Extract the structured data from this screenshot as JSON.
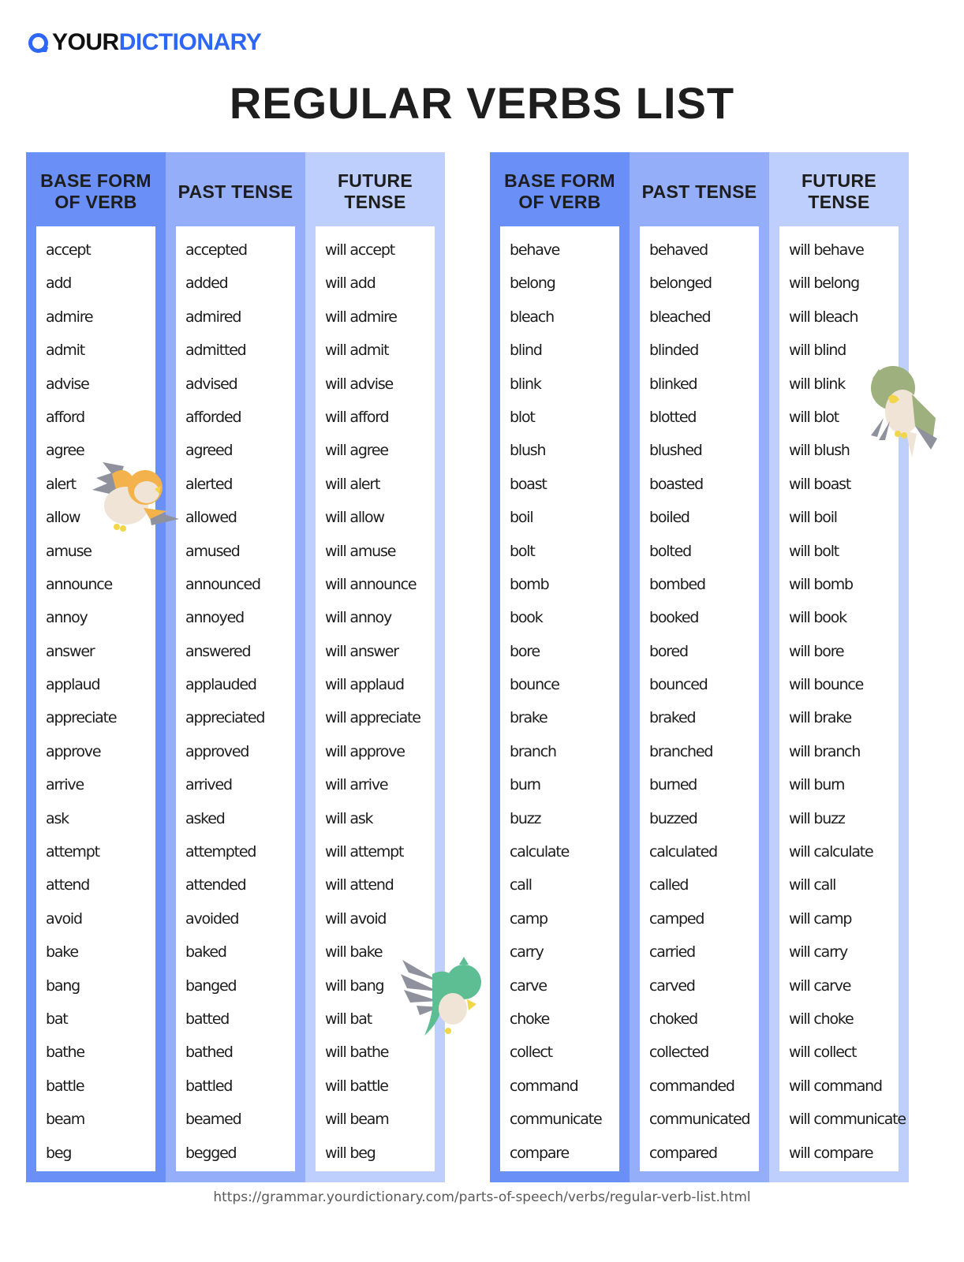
{
  "brand": {
    "logo_icon": "search-magnifier-icon",
    "name_part1": "YOUR",
    "name_part2": "DICTIONARY",
    "colors": {
      "primary": "#2e66f5",
      "dark": "#111111"
    }
  },
  "title": "REGULAR VERBS LIST",
  "colors": {
    "base_column": "#6a8ff7",
    "past_column": "#95aefa",
    "future_column": "#bfcffd"
  },
  "tables": [
    {
      "headers": {
        "base": "BASE FORM OF VERB",
        "past": "PAST TENSE",
        "future": "FUTURE TENSE"
      },
      "base": [
        "accept",
        "add",
        "admire",
        "admit",
        "advise",
        "afford",
        "agree",
        "alert",
        "allow",
        "amuse",
        "announce",
        "annoy",
        "answer",
        "applaud",
        "appreciate",
        "approve",
        "arrive",
        "ask",
        "attempt",
        "attend",
        "avoid",
        "bake",
        "bang",
        "bat",
        "bathe",
        "battle",
        "beam",
        "beg"
      ],
      "past": [
        "accepted",
        "added",
        "admired",
        "admitted",
        "advised",
        "afforded",
        "agreed",
        "alerted",
        "allowed",
        "amused",
        "announced",
        "annoyed",
        "answered",
        "applauded",
        "appreciated",
        "approved",
        "arrived",
        "asked",
        "attempted",
        "attended",
        "avoided",
        "baked",
        "banged",
        "batted",
        "bathed",
        "battled",
        "beamed",
        "begged"
      ],
      "future": [
        "will accept",
        "will add",
        "will admire",
        "will admit",
        "will advise",
        "will afford",
        "will agree",
        "will alert",
        "will allow",
        "will amuse",
        "will announce",
        "will annoy",
        "will answer",
        "will applaud",
        "will appreciate",
        "will approve",
        "will arrive",
        "will ask",
        "will attempt",
        "will attend",
        "will avoid",
        "will bake",
        "will bang",
        "will bat",
        "will bathe",
        "will battle",
        "will beam",
        "will beg"
      ]
    },
    {
      "headers": {
        "base": "BASE FORM OF VERB",
        "past": "PAST TENSE",
        "future": "FUTURE TENSE"
      },
      "base": [
        "behave",
        "belong",
        "bleach",
        "blind",
        "blink",
        "blot",
        "blush",
        "boast",
        "boil",
        "bolt",
        "bomb",
        "book",
        "bore",
        "bounce",
        "brake",
        "branch",
        "burn",
        "buzz",
        "calculate",
        "call",
        "camp",
        "carry",
        "carve",
        "choke",
        "collect",
        "command",
        "communicate",
        "compare"
      ],
      "past": [
        "behaved",
        "belonged",
        "bleached",
        "blinded",
        "blinked",
        "blotted",
        "blushed",
        "boasted",
        "boiled",
        "bolted",
        "bombed",
        "booked",
        "bored",
        "bounced",
        "braked",
        "branched",
        "burned",
        "buzzed",
        "calculated",
        "called",
        "camped",
        "carried",
        "carved",
        "choked",
        "collected",
        "commanded",
        "communicated",
        "compared"
      ],
      "future": [
        "will behave",
        "will belong",
        "will bleach",
        "will blind",
        "will blink",
        "will blot",
        "will blush",
        "will boast",
        "will boil",
        "will bolt",
        "will bomb",
        "will book",
        "will bore",
        "will bounce",
        "will brake",
        "will branch",
        "will burn",
        "will buzz",
        "will calculate",
        "will call",
        "will camp",
        "will carry",
        "will carve",
        "will choke",
        "will collect",
        "will command",
        "will communicate",
        "will compare"
      ]
    }
  ],
  "decorations": [
    "orange-bird-illustration",
    "green-parrot-illustration",
    "teal-bird-illustration"
  ],
  "footer_url": "https://grammar.yourdictionary.com/parts-of-speech/verbs/regular-verb-list.html"
}
